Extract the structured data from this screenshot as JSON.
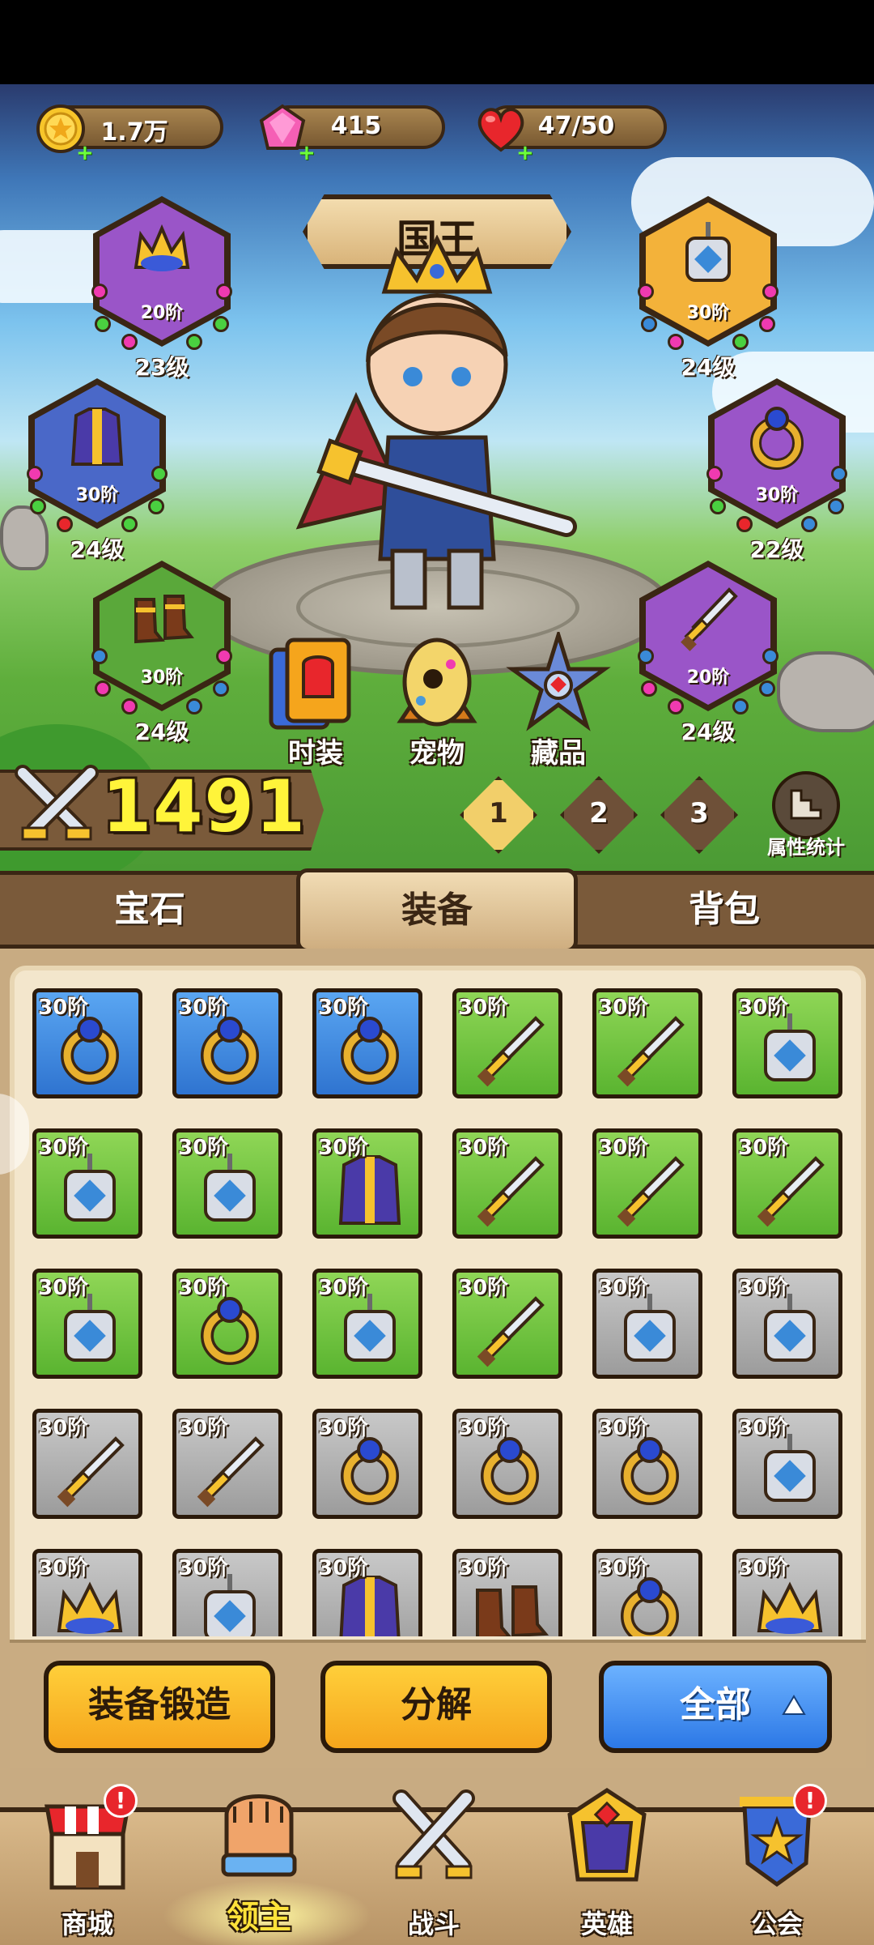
{
  "resources": {
    "gold": "1.7万",
    "gems": "415",
    "stamina": "47/50"
  },
  "character": {
    "title": "国王"
  },
  "equipment_slots": [
    {
      "id": "crown",
      "tier": "20阶",
      "level": "23级"
    },
    {
      "id": "amulet",
      "tier": "30阶",
      "level": "24级"
    },
    {
      "id": "armor",
      "tier": "30阶",
      "level": "24级"
    },
    {
      "id": "ring",
      "tier": "30阶",
      "level": "22级"
    },
    {
      "id": "boots",
      "tier": "30阶",
      "level": "24级"
    },
    {
      "id": "sword",
      "tier": "20阶",
      "level": "24级"
    }
  ],
  "quick_buttons": {
    "costume": "时装",
    "pet": "宠物",
    "collection": "藏品"
  },
  "power": "1491",
  "presets": [
    "1",
    "2",
    "3"
  ],
  "stats_label": "属性统计",
  "tabs": {
    "gems": "宝石",
    "equipment": "装备",
    "bag": "背包"
  },
  "inventory": [
    {
      "tier": "30阶",
      "item": "ring",
      "rarity": "blue"
    },
    {
      "tier": "30阶",
      "item": "ring",
      "rarity": "blue"
    },
    {
      "tier": "30阶",
      "item": "ring",
      "rarity": "blue"
    },
    {
      "tier": "30阶",
      "item": "sword",
      "rarity": "green"
    },
    {
      "tier": "30阶",
      "item": "sword",
      "rarity": "green"
    },
    {
      "tier": "30阶",
      "item": "amulet",
      "rarity": "green"
    },
    {
      "tier": "30阶",
      "item": "amulet",
      "rarity": "green"
    },
    {
      "tier": "30阶",
      "item": "amulet",
      "rarity": "green"
    },
    {
      "tier": "30阶",
      "item": "armor",
      "rarity": "green"
    },
    {
      "tier": "30阶",
      "item": "sword",
      "rarity": "green"
    },
    {
      "tier": "30阶",
      "item": "sword",
      "rarity": "green"
    },
    {
      "tier": "30阶",
      "item": "sword",
      "rarity": "green"
    },
    {
      "tier": "30阶",
      "item": "amulet",
      "rarity": "green"
    },
    {
      "tier": "30阶",
      "item": "ring",
      "rarity": "green"
    },
    {
      "tier": "30阶",
      "item": "amulet",
      "rarity": "green"
    },
    {
      "tier": "30阶",
      "item": "sword",
      "rarity": "green"
    },
    {
      "tier": "30阶",
      "item": "amulet",
      "rarity": "gray"
    },
    {
      "tier": "30阶",
      "item": "amulet",
      "rarity": "gray"
    },
    {
      "tier": "30阶",
      "item": "sword",
      "rarity": "gray"
    },
    {
      "tier": "30阶",
      "item": "sword",
      "rarity": "gray"
    },
    {
      "tier": "30阶",
      "item": "ring",
      "rarity": "gray"
    },
    {
      "tier": "30阶",
      "item": "ring",
      "rarity": "gray"
    },
    {
      "tier": "30阶",
      "item": "ring",
      "rarity": "gray"
    },
    {
      "tier": "30阶",
      "item": "amulet",
      "rarity": "gray"
    },
    {
      "tier": "30阶",
      "item": "crown",
      "rarity": "gray"
    },
    {
      "tier": "30阶",
      "item": "amulet",
      "rarity": "gray"
    },
    {
      "tier": "30阶",
      "item": "armor",
      "rarity": "gray"
    },
    {
      "tier": "30阶",
      "item": "boots",
      "rarity": "gray"
    },
    {
      "tier": "30阶",
      "item": "ring",
      "rarity": "gray"
    },
    {
      "tier": "30阶",
      "item": "crown",
      "rarity": "gray"
    }
  ],
  "actions": {
    "forge": "装备锻造",
    "decompose": "分解",
    "filter": "全部"
  },
  "nav": {
    "shop": "商城",
    "lord": "领主",
    "battle": "战斗",
    "heroes": "英雄",
    "guild": "公会",
    "badge": "!"
  },
  "colors": {
    "rarity_blue": "#2f74d0",
    "rarity_green": "#5ab430",
    "rarity_gray": "#9c9c9c",
    "power_yellow": "#fff43a",
    "button_orange": "#f5a51c",
    "button_blue": "#2c78e6"
  }
}
